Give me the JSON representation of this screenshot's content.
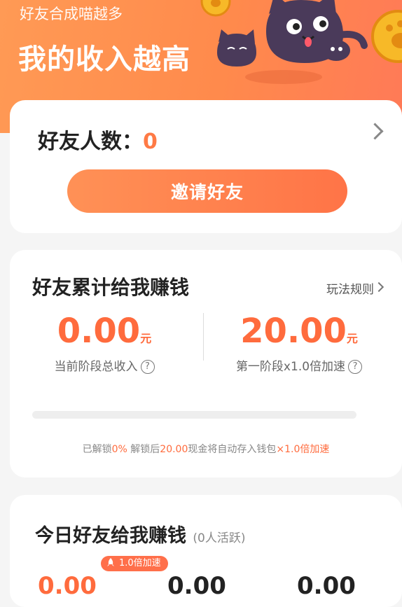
{
  "header": {
    "subtitle": "好友合成喵越多",
    "title": "我的收入越高"
  },
  "friends_card": {
    "label": "好友人数：",
    "count": "0",
    "invite_button": "邀请好友"
  },
  "earnings_card": {
    "title": "好友累计给我赚钱",
    "rules_link": "玩法规则",
    "current_income": {
      "value": "0.00",
      "unit": "元",
      "label": "当前阶段总收入"
    },
    "stage_target": {
      "value": "20.00",
      "unit": "元",
      "label": "第一阶段x1.0倍加速"
    },
    "progress_percent": 0,
    "unlock_note": {
      "prefix": "已解锁",
      "percent": "0%",
      "middle": " 解锁后",
      "amount": "20.00",
      "suffix": "现金将自动存入钱包",
      "boost": "×1.0倍加速"
    }
  },
  "today_card": {
    "title": "今日好友给我赚钱",
    "active": "(0人活跃)",
    "speed_badge": "1.0倍加速",
    "values": [
      "0.00",
      "0.00",
      "0.00"
    ]
  },
  "colors": {
    "accent": "#ff6b3d",
    "header_bg": "#ff8a4c"
  }
}
